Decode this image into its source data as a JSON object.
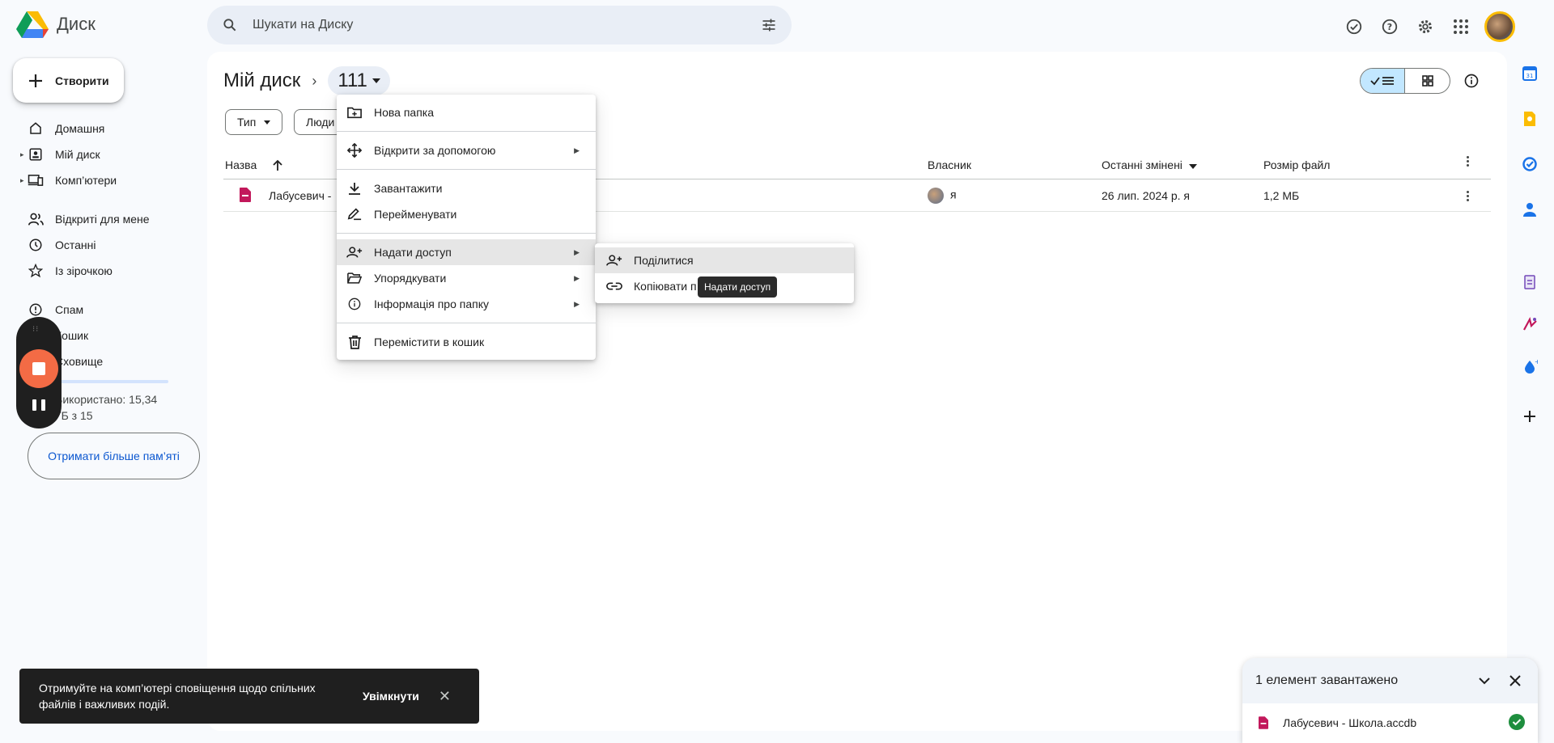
{
  "app": {
    "name": "Диск"
  },
  "search": {
    "placeholder": "Шукати на Диску"
  },
  "create_label": "Створити",
  "nav": {
    "items": [
      {
        "label": "Домашня"
      },
      {
        "label": "Мій диск"
      },
      {
        "label": "Комп’ютери"
      },
      {
        "label": "Відкриті для мене"
      },
      {
        "label": "Останні"
      },
      {
        "label": "Із зірочкою"
      },
      {
        "label": "Спам"
      },
      {
        "label": "Кошик"
      },
      {
        "label": "Сховище"
      }
    ],
    "storage_text": "Використано: 15,34 ГБ з 15",
    "storage_fraction": 0.06,
    "more_storage": "Отримати більше пам’яті"
  },
  "breadcrumb": {
    "root": "Мій диск",
    "current": "111"
  },
  "filters": {
    "type": "Тип",
    "people": "Люди"
  },
  "table": {
    "headers": {
      "name": "Назва",
      "owner": "Власник",
      "modified": "Останні змінені",
      "size": "Розмір файл"
    },
    "rows": [
      {
        "name": "Лабусевич -",
        "owner": "я",
        "modified": "26 лип. 2024 р. я",
        "size": "1,2 МБ"
      }
    ]
  },
  "context_menu": {
    "new_folder": "Нова папка",
    "open_with": "Відкрити за допомогою",
    "download": "Завантажити",
    "rename": "Перейменувати",
    "share": "Надати доступ",
    "organize": "Упорядкувати",
    "folder_info": "Інформація про папку",
    "trash": "Перемістити в кошик"
  },
  "submenu": {
    "share": "Поділитися",
    "copy_link": "Копіювати п"
  },
  "tooltip": "Надати доступ",
  "toast": {
    "text": "Отримуйте на комп’ютері сповіщення щодо спільних файлів і важливих подій.",
    "button": "Увімкнути"
  },
  "upload_panel": {
    "title": "1 елемент завантажено",
    "file": "Лабусевич - Школа.accdb"
  },
  "colors": {
    "accent": "#0b57d0",
    "toggle_on": "#c2e7ff",
    "record": "#f36b45",
    "success": "#1e8e3e",
    "file_icon": "#c2185b"
  }
}
